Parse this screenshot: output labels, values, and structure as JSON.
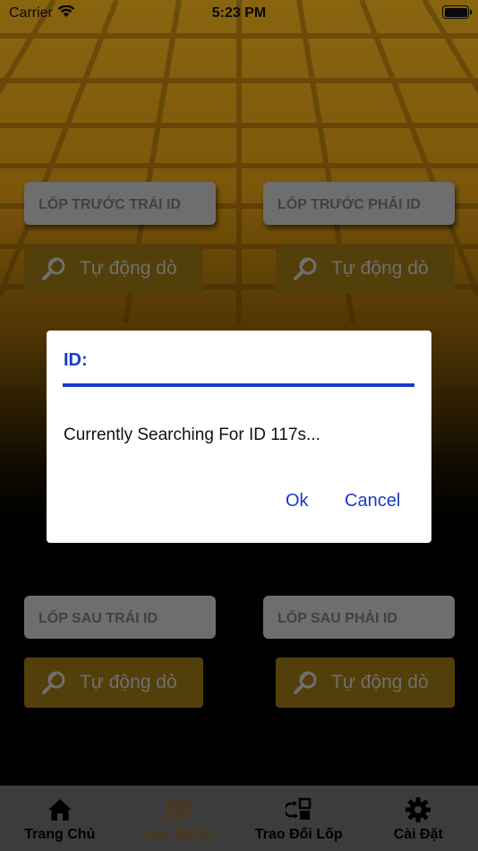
{
  "status_bar": {
    "carrier": "Carrier",
    "time": "5:23 PM"
  },
  "front": {
    "left_label": "LỐP TRƯỚC TRÁI ID",
    "right_label": "LỐP TRƯỚC PHẢI ID",
    "left_scan": "Tự động dò",
    "right_scan": "Tự động dò"
  },
  "rear": {
    "left_label": "LỐP SAU TRÁI ID",
    "right_label": "LỐP SAU PHẢI ID",
    "left_scan": "Tự động dò",
    "right_scan": "Tự động dò"
  },
  "dialog": {
    "title": "ID:",
    "message": "Currently Searching For ID 117s...",
    "ok": "Ok",
    "cancel": "Cancel"
  },
  "tabs": [
    {
      "label": "Trang Chủ",
      "icon": "home-icon"
    },
    {
      "label": "Học Mã ID",
      "icon": "learn-id-icon",
      "active": true
    },
    {
      "label": "Trao Đổi Lốp",
      "icon": "swap-tire-icon"
    },
    {
      "label": "Cài Đặt",
      "icon": "gear-icon"
    }
  ],
  "colors": {
    "accent": "#1a3acb",
    "active_tab": "#8a5a1e",
    "scan_button": "#8b6a12",
    "tab_bar": "#646464"
  }
}
